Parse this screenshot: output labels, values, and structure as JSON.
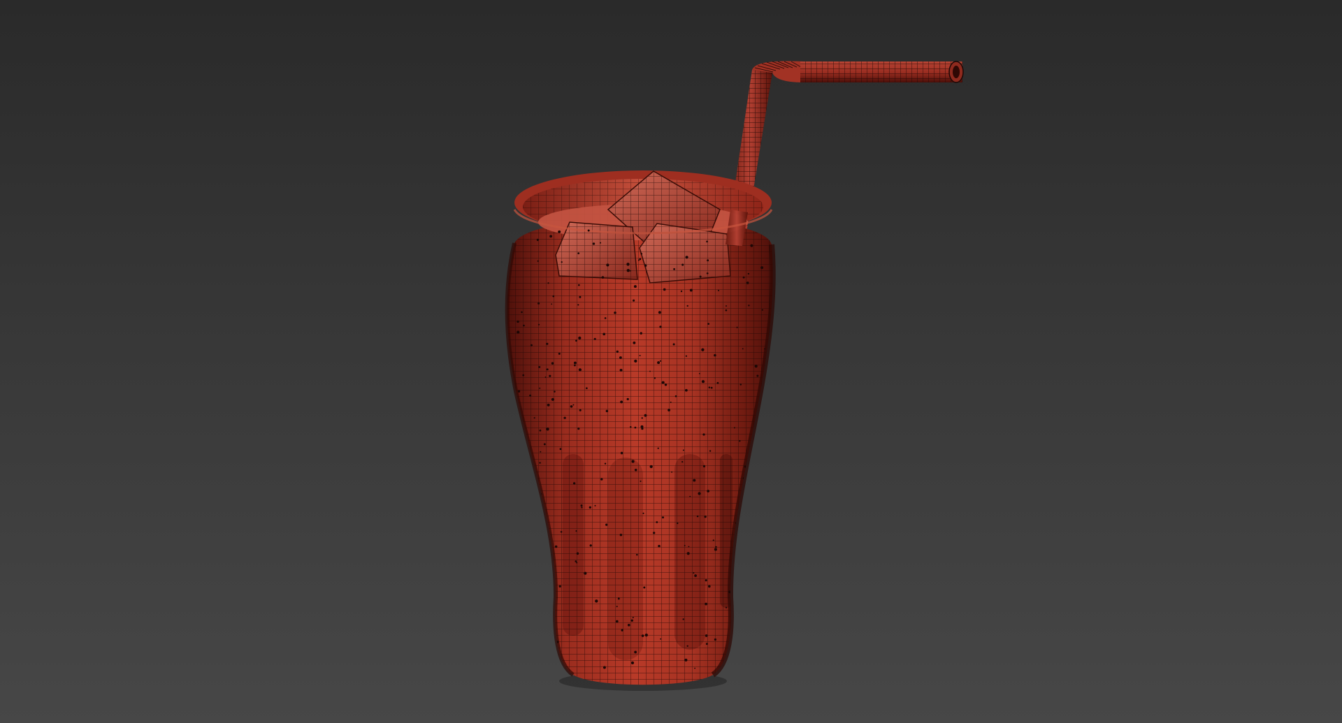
{
  "viewport": {
    "background_top": "#2a2a2a",
    "background_bottom": "#474747"
  },
  "model": {
    "wireframe_color": "#1c0705",
    "glass": {
      "base_color": "#b83a28",
      "shade_color": "#4e100a",
      "highlight_color": "#d86450"
    },
    "ice": {
      "base_color": "#c55c4c",
      "shade_color": "#6a1c14"
    },
    "straw": {
      "base_color": "#a83325",
      "shade_color": "#4a0e08"
    }
  }
}
